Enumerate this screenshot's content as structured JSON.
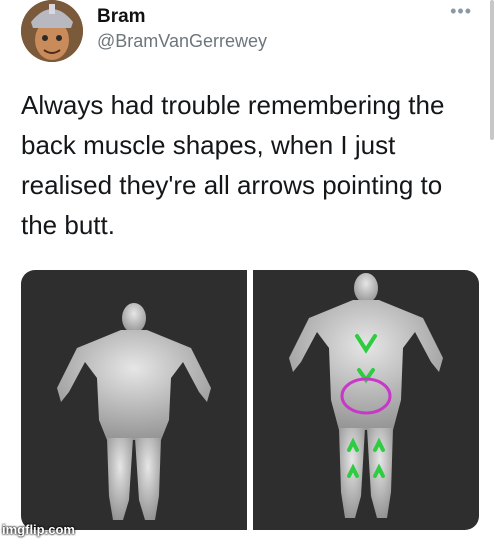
{
  "tweet": {
    "display_name": "Bram",
    "handle": "@BramVanGerrewey",
    "text": "Always had trouble remembering the back muscle shapes, when I just realised they're all arrows pointing to the butt.",
    "more_glyph": "•••"
  },
  "media": {
    "left_panel_icon": "muscle-back-figure",
    "right_panel_icon": "muscle-back-figure-annotated",
    "annotation_colors": {
      "arrows": "#2ecc40",
      "circle": "#c837c8"
    }
  },
  "watermark": "imgflip.com"
}
